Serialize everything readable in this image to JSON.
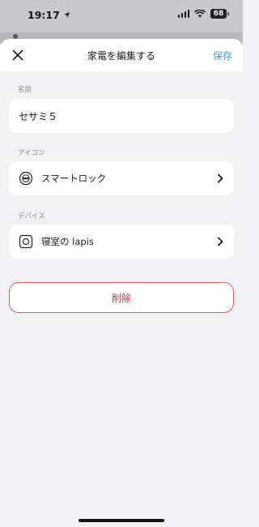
{
  "status_bar": {
    "time": "19:17",
    "battery": "68"
  },
  "nav": {
    "title": "家電を編集する",
    "save_label": "保存"
  },
  "name_section": {
    "label": "名前",
    "value": "セサミ５"
  },
  "icon_section": {
    "label": "アイコン",
    "value": "スマートロック",
    "icon": "smart-lock-icon"
  },
  "device_section": {
    "label": "デバイス",
    "value": "寝室の lapis",
    "icon": "device-square-icon"
  },
  "delete_label": "削除",
  "colors": {
    "accent": "#3a9de6",
    "danger": "#d9363e",
    "background": "#f2f2f4"
  }
}
